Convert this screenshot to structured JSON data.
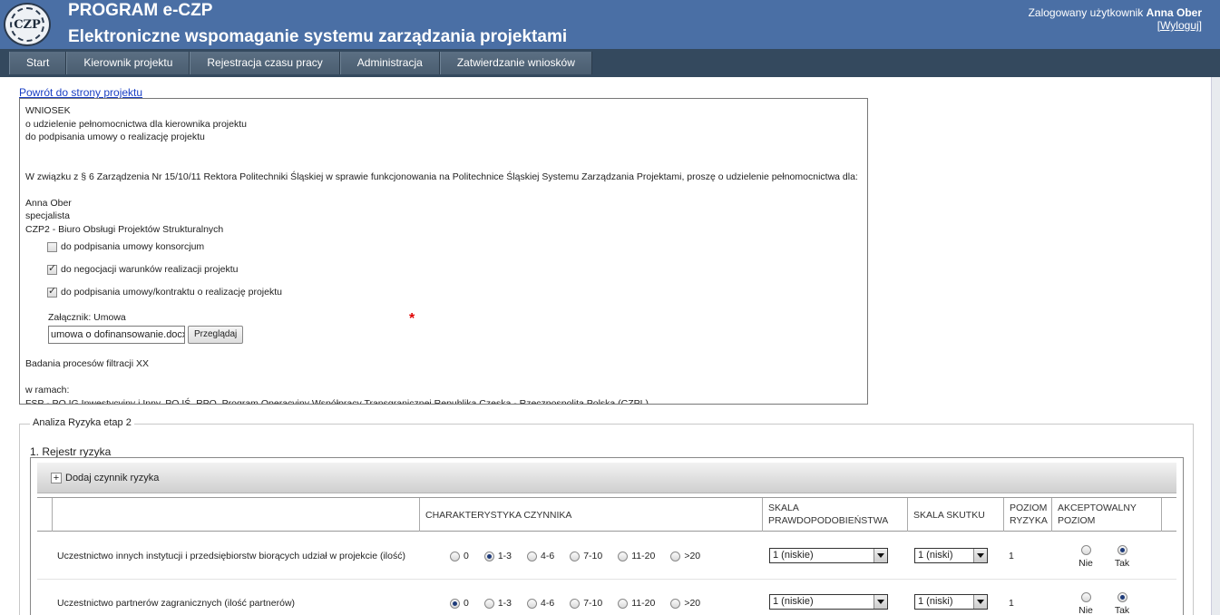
{
  "header": {
    "logo_text": "CZP",
    "app_name": "PROGRAM e-CZP",
    "app_subtitle": "Elektroniczne wspomaganie systemu zarządzania projektami",
    "user_prefix": "Zalogowany użytkownik",
    "user_name": "Anna Ober",
    "logout": "[Wyloguj]"
  },
  "nav": [
    "Start",
    "Kierownik projektu",
    "Rejestracja czasu pracy",
    "Administracja",
    "Zatwierdzanie wniosków"
  ],
  "back_link": "Powrót do strony projektu",
  "request": {
    "title_lines": [
      "WNIOSEK",
      "o udzielenie pełnomocnictwa dla kierownika projektu",
      "do podpisania umowy o realizację projektu"
    ],
    "intro": "W związku z § 6 Zarządzenia Nr 15/10/11 Rektora Politechniki Śląskiej w sprawie funkcjonowania na Politechnice Śląskiej Systemu Zarządzania Projektami, proszę o udzielenie pełnomocnictwa dla:",
    "person": [
      "Anna Ober",
      "specjalista",
      "CZP2 - Biuro Obsługi Projektów Strukturalnych"
    ],
    "options": [
      {
        "label": "do podpisania umowy konsorcjum",
        "checked": false
      },
      {
        "label": "do negocjacji warunków realizacji projektu",
        "checked": true
      },
      {
        "label": "do podpisania umowy/kontraktu o realizację projektu",
        "checked": true
      }
    ],
    "attachment_label": "Załącznik: Umowa",
    "attachment_value": "umowa o dofinansowanie.docx",
    "browse_label": "Przeglądaj",
    "required_mark": "*",
    "project_name": "Badania procesów filtracji XX",
    "within_label": "w ramach:",
    "program": "FSP - PO IG Inwestycyjny i Inny, PO IŚ, RPO, Program Operacyjny Współpracy Transgranicznej Republika Czeska - Rzeczpospolita Polska (CZPL)"
  },
  "risk": {
    "legend": "Analiza Ryzyka etap 2",
    "register_title": "1. Rejestr ryzyka",
    "add_label": "Dodaj czynnik ryzyka",
    "add_icon": "+",
    "columns": {
      "characteristic": "CHARAKTERYSTYKA CZYNNIKA",
      "probability": [
        "SKALA",
        "PRAWDOPODOBIEŃSTWA"
      ],
      "effect": "SKALA SKUTKU",
      "level": [
        "POZIOM",
        "RYZYKA"
      ],
      "acceptable": [
        "AKCEPTOWALNY",
        "POZIOM"
      ]
    },
    "radio_options": [
      "0",
      "1-3",
      "4-6",
      "7-10",
      "11-20",
      ">20"
    ],
    "rows": [
      {
        "label": "Uczestnictwo innych instytucji i przedsiębiorstw biorących udział w projekcie (ilość)",
        "selected": "1-3",
        "probability": "1 (niskie)",
        "effect": "1 (niski)",
        "level": "1",
        "accept_no": "Nie",
        "accept_yes": "Tak",
        "accepted": true
      },
      {
        "label": "Uczestnictwo partnerów zagranicznych (ilość partnerów)",
        "selected": "0",
        "probability": "1 (niskie)",
        "effect": "1 (niski)",
        "level": "1",
        "accept_no": "Nie",
        "accept_yes": "Tak",
        "accepted": true
      }
    ]
  }
}
